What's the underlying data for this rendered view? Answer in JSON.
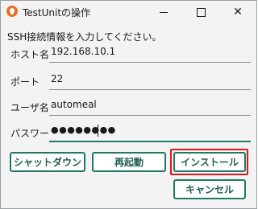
{
  "window": {
    "title": "TestUnitの操作",
    "minimize": "minimize",
    "maximize": "maximize",
    "close": "close"
  },
  "form": {
    "instruction": "SSH接続情報を入力してください。",
    "host_label": "ホスト名",
    "host_value": "192.168.10.1",
    "port_label": "ポート",
    "port_value": "22",
    "user_label": "ユーザ名",
    "user_value": "automeal",
    "password_label": "パスワード",
    "password_value": "●●●●●●●●"
  },
  "buttons": {
    "shutdown": "シャットダウン",
    "restart": "再起動",
    "install": "インストール",
    "cancel": "キャンセル"
  },
  "colors": {
    "accent": "#1f7a63",
    "highlight": "#e0151a",
    "app_icon": "#e8702a"
  }
}
